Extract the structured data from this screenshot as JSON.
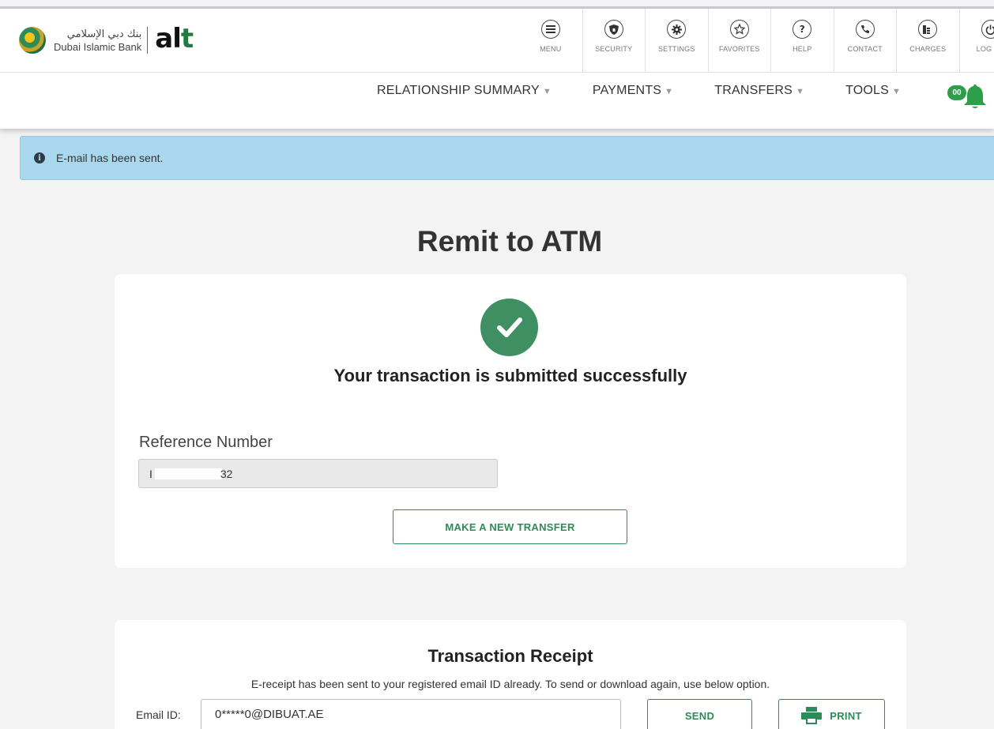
{
  "brand": {
    "name_arabic": "بنك دبي الإسلامي",
    "name_english": "Dubai Islamic Bank",
    "product": "alt"
  },
  "icon_bar": [
    {
      "label": "MENU",
      "icon": "menu-icon"
    },
    {
      "label": "SECURITY",
      "icon": "shield-icon"
    },
    {
      "label": "SETTINGS",
      "icon": "gear-icon"
    },
    {
      "label": "FAVORITES",
      "icon": "star-icon"
    },
    {
      "label": "HELP",
      "icon": "question-icon"
    },
    {
      "label": "CONTACT",
      "icon": "phone-icon"
    },
    {
      "label": "CHARGES",
      "icon": "coins-icon"
    },
    {
      "label": "LOG OU",
      "icon": "power-icon"
    }
  ],
  "main_nav": [
    {
      "label": "RELATIONSHIP SUMMARY"
    },
    {
      "label": "PAYMENTS"
    },
    {
      "label": "TRANSFERS"
    },
    {
      "label": "TOOLS"
    }
  ],
  "notifications": {
    "badge": "00"
  },
  "alert": {
    "message": "E-mail has been sent."
  },
  "page": {
    "title": "Remit to ATM"
  },
  "confirmation": {
    "message": "Your transaction is submitted successfully",
    "reference_label": "Reference Number",
    "reference_prefix": "I",
    "reference_suffix": "32",
    "new_transfer_label": "MAKE A NEW TRANSFER"
  },
  "receipt": {
    "title": "Transaction Receipt",
    "description": "E-receipt has been sent to your registered email ID already. To send or download again, use below option.",
    "email_label": "Email ID:",
    "email_value": "0*****0@DIBUAT.AE",
    "send_label": "SEND",
    "print_label": "PRINT"
  },
  "colors": {
    "brand_green": "#2e8b57",
    "success_green": "#3f8f63",
    "alert_blue": "#a9d8ee"
  }
}
